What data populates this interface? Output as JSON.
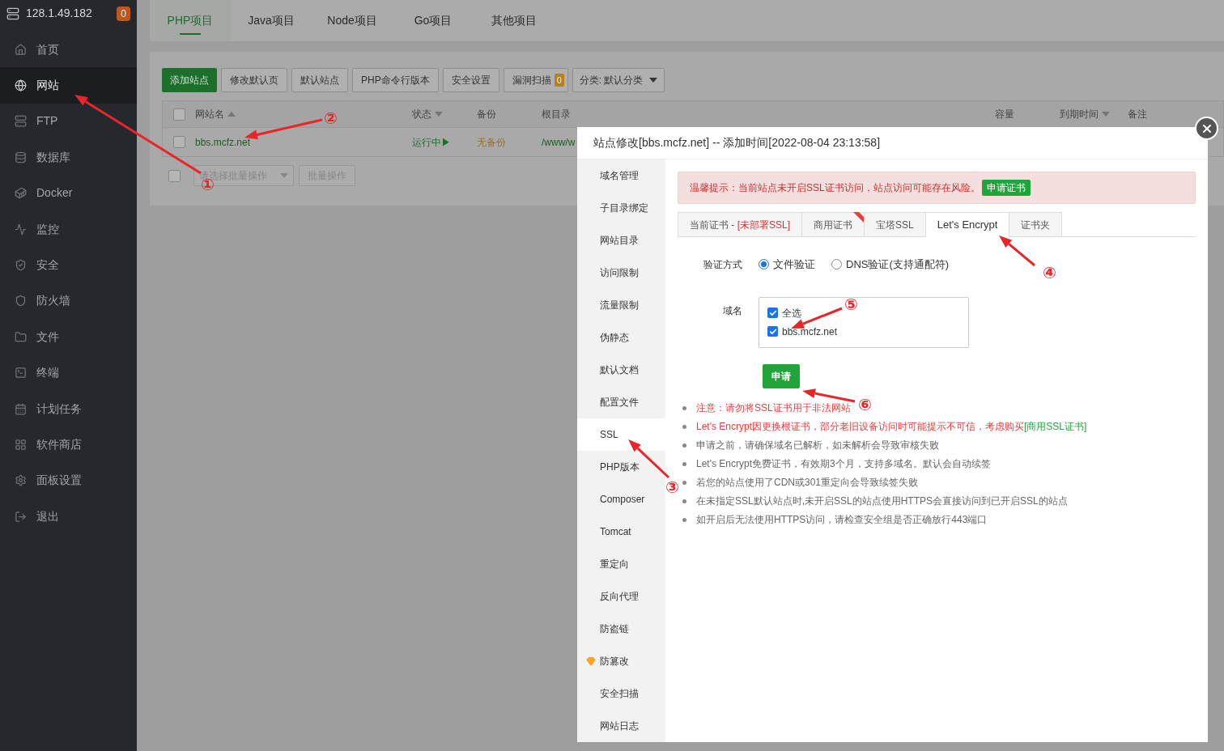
{
  "sidebar": {
    "host": "128.1.49.182",
    "badge": "0",
    "items": [
      {
        "label": "首页",
        "selected": false
      },
      {
        "label": "网站",
        "selected": true
      },
      {
        "label": "FTP",
        "selected": false
      },
      {
        "label": "数据库",
        "selected": false
      },
      {
        "label": "Docker",
        "selected": false
      },
      {
        "label": "监控",
        "selected": false
      },
      {
        "label": "安全",
        "selected": false
      },
      {
        "label": "防火墙",
        "selected": false
      },
      {
        "label": "文件",
        "selected": false
      },
      {
        "label": "终端",
        "selected": false
      },
      {
        "label": "计划任务",
        "selected": false
      },
      {
        "label": "软件商店",
        "selected": false
      },
      {
        "label": "面板设置",
        "selected": false
      },
      {
        "label": "退出",
        "selected": false
      }
    ]
  },
  "project_tabs": [
    {
      "label": "PHP项目",
      "selected": true
    },
    {
      "label": "Java项目",
      "selected": false
    },
    {
      "label": "Node项目",
      "selected": false
    },
    {
      "label": "Go项目",
      "selected": false
    },
    {
      "label": "其他项目",
      "selected": false
    }
  ],
  "toolbar": {
    "buttons": [
      {
        "label": "添加站点",
        "kind": "primary"
      },
      {
        "label": "修改默认页",
        "kind": "plain"
      },
      {
        "label": "默认站点",
        "kind": "plain"
      },
      {
        "label": "PHP命令行版本",
        "kind": "plain"
      },
      {
        "label": "安全设置",
        "kind": "plain"
      },
      {
        "label": "漏洞扫描",
        "kind": "counter",
        "count": "0"
      }
    ],
    "category": "分类: 默认分类"
  },
  "table": {
    "all_checked": false,
    "columns": [
      {
        "label": "网站名",
        "sort_ascending": true,
        "sort_descending": false
      },
      {
        "label": "状态",
        "sort_ascending": false,
        "sort_descending": true
      },
      {
        "label": "备份",
        "sort_ascending": false,
        "sort_descending": false
      },
      {
        "label": "根目录",
        "sort_ascending": false,
        "sort_descending": false
      },
      {
        "label": "容量",
        "sort_ascending": false,
        "sort_descending": false
      },
      {
        "label": "到期时间",
        "sort_ascending": false,
        "sort_descending": true
      },
      {
        "label": "备注",
        "sort_ascending": false,
        "sort_descending": false
      }
    ],
    "rows": [
      {
        "checked": false,
        "name": "bbs.mcfz.net",
        "status": "运行中▶",
        "backup": "无备份",
        "root": "/www/w"
      }
    ]
  },
  "batch": {
    "checked": false,
    "placeholder": "请选择批量操作",
    "button": "批量操作"
  },
  "dialog": {
    "title": "站点修改[bbs.mcfz.net] -- 添加时间[2022-08-04 23:13:58]",
    "nav": [
      {
        "label": "域名管理",
        "selected": false,
        "premium": false
      },
      {
        "label": "子目录绑定",
        "selected": false,
        "premium": false
      },
      {
        "label": "网站目录",
        "selected": false,
        "premium": false
      },
      {
        "label": "访问限制",
        "selected": false,
        "premium": false
      },
      {
        "label": "流量限制",
        "selected": false,
        "premium": false
      },
      {
        "label": "伪静态",
        "selected": false,
        "premium": false
      },
      {
        "label": "默认文档",
        "selected": false,
        "premium": false
      },
      {
        "label": "配置文件",
        "selected": false,
        "premium": false
      },
      {
        "label": "SSL",
        "selected": true,
        "premium": false
      },
      {
        "label": "PHP版本",
        "selected": false,
        "premium": false
      },
      {
        "label": "Composer",
        "selected": false,
        "premium": false
      },
      {
        "label": "Tomcat",
        "selected": false,
        "premium": false
      },
      {
        "label": "重定向",
        "selected": false,
        "premium": false
      },
      {
        "label": "反向代理",
        "selected": false,
        "premium": false
      },
      {
        "label": "防盗链",
        "selected": false,
        "premium": false
      },
      {
        "label": "防篡改",
        "selected": false,
        "premium": true
      },
      {
        "label": "安全扫描",
        "selected": false,
        "premium": false
      },
      {
        "label": "网站日志",
        "selected": false,
        "premium": false
      }
    ],
    "alert": {
      "text": "温馨提示：当前站点未开启SSL证书访问，站点访问可能存在风险。",
      "button": "申请证书"
    },
    "ssl_tabs": [
      {
        "label": "当前证书 - ",
        "note": "[未部署SSL]",
        "selected": false
      },
      {
        "label": "商用证书",
        "ribbon": true,
        "selected": false
      },
      {
        "label": "宝塔SSL",
        "selected": false
      },
      {
        "label": "Let's Encrypt",
        "selected": true
      },
      {
        "label": "证书夹",
        "selected": false
      }
    ],
    "verify": {
      "label": "验证方式",
      "options": [
        {
          "label": "文件验证",
          "selected": true
        },
        {
          "label": "DNS验证(支持通配符)",
          "selected": false
        }
      ]
    },
    "domains": {
      "label": "域名",
      "items": [
        {
          "label": "全选",
          "checked": true
        },
        {
          "label": "bbs.mcfz.net",
          "checked": true
        }
      ]
    },
    "apply_button": "申请",
    "notes": [
      {
        "kind": "warning",
        "text": "注意：请勿将SSL证书用于非法网站"
      },
      {
        "kind": "warning",
        "text": "Let's Encrypt因更换根证书，部分老旧设备访问时可能提示不可信，考虑购买",
        "link": "[商用SSL证书]"
      },
      {
        "kind": "plain",
        "text": "申请之前，请确保域名已解析，如未解析会导致审核失败"
      },
      {
        "kind": "plain",
        "text": "Let's Encrypt免费证书，有效期3个月，支持多域名。默认会自动续签"
      },
      {
        "kind": "plain",
        "text": "若您的站点使用了CDN或301重定向会导致续签失败"
      },
      {
        "kind": "plain",
        "text": "在未指定SSL默认站点时,未开启SSL的站点使用HTTPS会直接访问到已开启SSL的站点"
      },
      {
        "kind": "plain",
        "text": "如开启后无法使用HTTPS访问，请检查安全组是否正确放行443端口"
      }
    ]
  },
  "annotations": [
    "①",
    "②",
    "③",
    "④",
    "⑤",
    "⑥"
  ]
}
